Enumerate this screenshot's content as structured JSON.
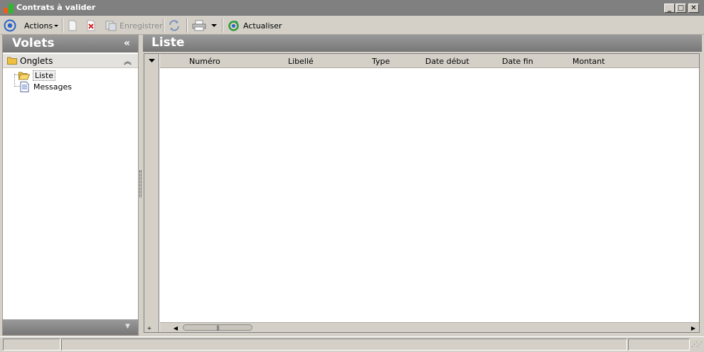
{
  "window": {
    "title": "Contrats à valider",
    "controls": {
      "minimize": "_",
      "maximize": "□",
      "close": "✕"
    }
  },
  "toolbar": {
    "actions_label": "Actions",
    "save_label": "Enregistrer",
    "refresh_label": "Actualiser"
  },
  "left_pane": {
    "title": "Volets",
    "collapse_glyph": "«",
    "section_label": "Onglets",
    "section_collapse_glyph": "︽",
    "tree_items": [
      {
        "label": "Liste",
        "icon": "folder-open-icon"
      },
      {
        "label": "Messages",
        "icon": "document-icon"
      }
    ]
  },
  "right_pane": {
    "title": "Liste",
    "columns": [
      "Numéro",
      "Libellé",
      "Type",
      "Date début",
      "Date fin",
      "Montant"
    ]
  },
  "colors": {
    "header_gray": "#808080",
    "face": "#d4d0c8"
  }
}
